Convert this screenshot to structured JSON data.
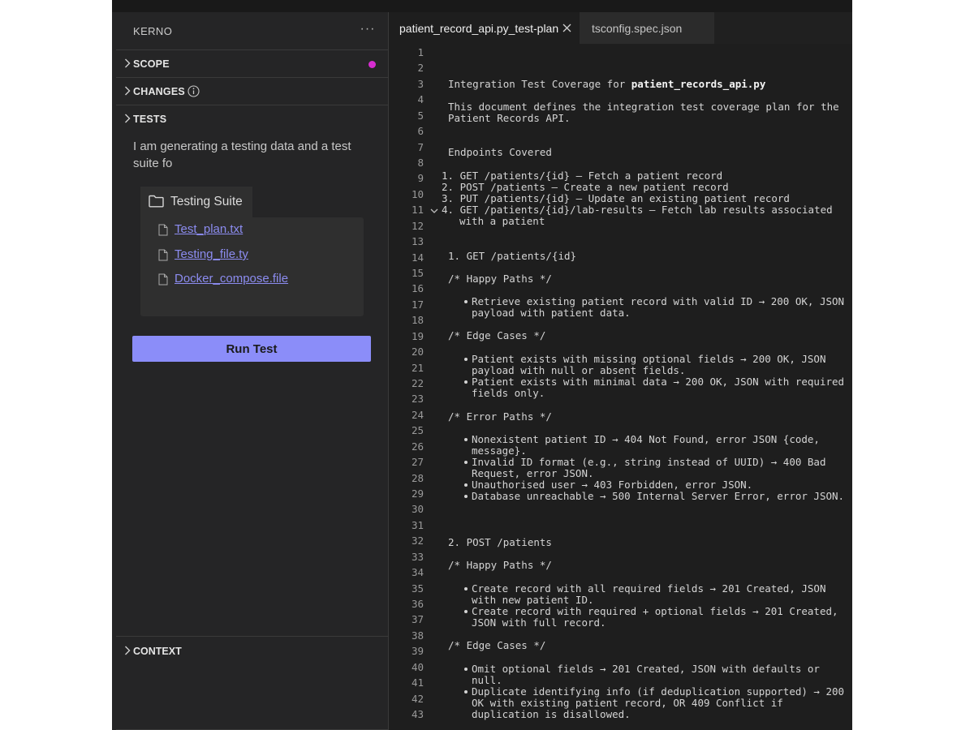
{
  "sidebar": {
    "title": "KERNO",
    "more_label": "···",
    "sections": {
      "scope": "SCOPE",
      "changes": "CHANGES",
      "tests": "TESTS",
      "context": "CONTEXT"
    },
    "tests_message": "I am generating a testing data and a test suite fo",
    "suite": {
      "name": "Testing Suite",
      "files": [
        "Test_plan.txt",
        "Testing_file.ty",
        "Docker_compose.file"
      ]
    },
    "run_button": "Run Test",
    "colors": {
      "scope_dot": "#d62dd0",
      "accent": "#8b8df9",
      "link": "#8c8cf0"
    }
  },
  "editor": {
    "tabs": [
      {
        "label": "patient_record_api.py_test-plan",
        "active": true
      },
      {
        "label": "tsconfig.spec.json",
        "active": false
      }
    ],
    "line_numbers": [
      "1",
      "2",
      "3",
      "4",
      "5",
      "6",
      "7",
      "8",
      "9",
      "10",
      "11",
      "12",
      "13",
      "14",
      "15",
      "16",
      "17",
      "18",
      "19",
      "20",
      "21",
      "22",
      "23",
      "24",
      "25",
      "26",
      "27",
      "28",
      "29",
      "30",
      "31",
      "32",
      "33",
      "34",
      "35",
      "36",
      "37",
      "38",
      "39",
      "40",
      "41",
      "42",
      "43"
    ],
    "title_prefix": "Integration Test Coverage for ",
    "title_file": "patient_records_api.py",
    "lines": {
      "intro_1": "This document defines the integration test coverage plan for the",
      "intro_2": "Patient Records API.",
      "endpoints_heading": "Endpoints Covered",
      "ep_1": "1. GET /patients/{id} – Fetch a patient record",
      "ep_2": "2. POST /patients – Create a new patient record",
      "ep_3": "3. PUT /patients/{id} – Update an existing patient record",
      "ep_4a": "4. GET /patients/{id}/lab-results – Fetch lab results associated",
      "ep_4b": "with a patient",
      "s1_heading": "1. GET /patients/{id}",
      "s1_happy": "/* Happy Paths */",
      "s1_h1a": "Retrieve existing patient record with valid ID → 200 OK, JSON",
      "s1_h1b": "payload with patient data.",
      "s1_edge": "/* Edge Cases */",
      "s1_e1a": "Patient exists with missing optional fields → 200 OK, JSON",
      "s1_e1b": "payload with null or absent fields.",
      "s1_e2a": "Patient exists with minimal data → 200 OK, JSON with required",
      "s1_e2b": "fields only.",
      "s1_error": "/* Error Paths */",
      "s1_r1a": "Nonexistent patient ID → 404 Not Found, error JSON {code,",
      "s1_r1b": "message}.",
      "s1_r2a": "Invalid ID format (e.g., string instead of UUID) → 400 Bad",
      "s1_r2b": "Request, error JSON.",
      "s1_r3": "Unauthorised user → 403 Forbidden, error JSON.",
      "s1_r4": "Database unreachable → 500 Internal Server Error, error JSON.",
      "s2_heading": "2. POST /patients",
      "s2_happy": "/* Happy Paths */",
      "s2_h1a": "Create record with all required fields → 201 Created, JSON",
      "s2_h1b": "with new patient ID.",
      "s2_h2a": "Create record with required + optional fields → 201 Created,",
      "s2_h2b": "JSON with full record.",
      "s2_edge": "/* Edge Cases */",
      "s2_e1a": "Omit optional fields → 201 Created, JSON with defaults or",
      "s2_e1b": "null.",
      "s2_e2a": "Duplicate identifying info (if deduplication supported) → 200",
      "s2_e2b": "OK with existing patient record, OR 409 Conflict if",
      "s2_e2c": "duplication is disallowed."
    }
  }
}
